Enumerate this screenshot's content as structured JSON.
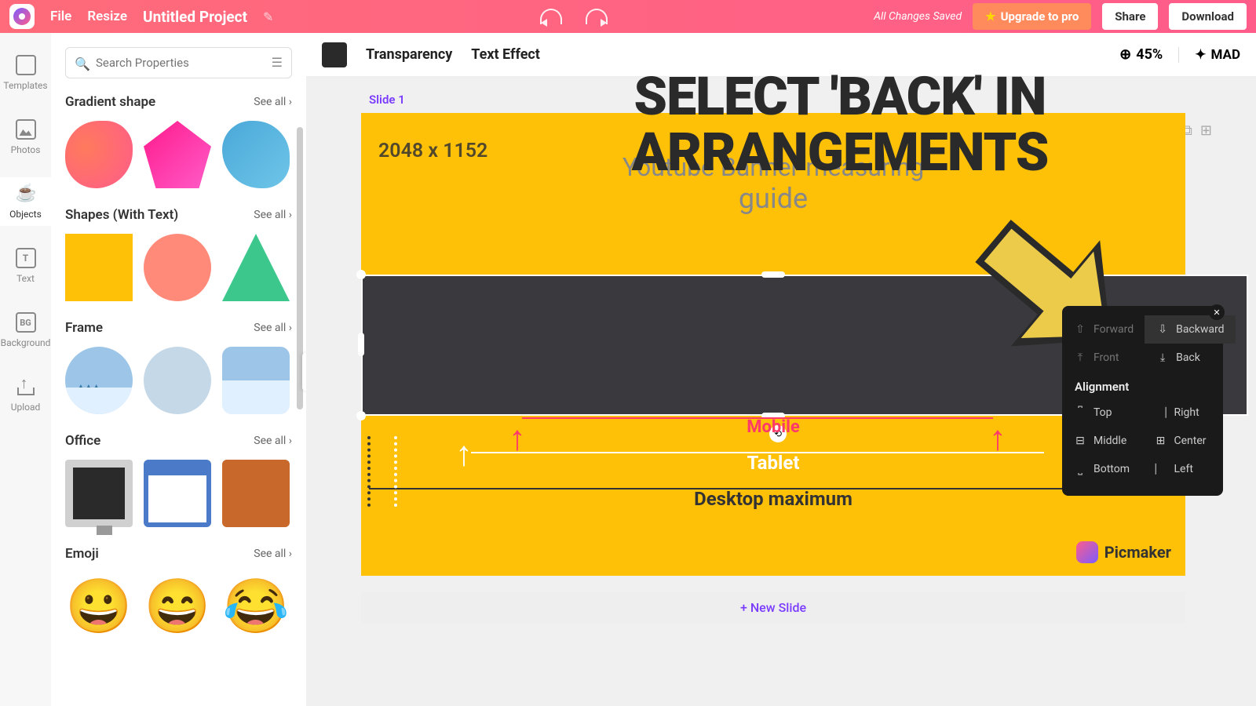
{
  "topbar": {
    "file": "File",
    "resize": "Resize",
    "project_title": "Untitled Project",
    "saved": "All Changes Saved",
    "upgrade": "Upgrade to pro",
    "share": "Share",
    "download": "Download"
  },
  "secbar": {
    "transparency": "Transparency",
    "text_effect": "Text Effect",
    "zoom": "45%",
    "mad": "MAD"
  },
  "rail": {
    "templates": "Templates",
    "photos": "Photos",
    "objects": "Objects",
    "text": "Text",
    "background": "Background",
    "upload": "Upload"
  },
  "panel": {
    "search_placeholder": "Search Properties",
    "see_all": "See all",
    "sections": {
      "gradient": "Gradient shape",
      "shapes_text": "Shapes (With Text)",
      "frame": "Frame",
      "office": "Office",
      "emoji": "Emoji"
    }
  },
  "canvas": {
    "slide_label": "Slide 1",
    "dimensions": "2048 x 1152",
    "subtitle_l1": "Youtube Banner measuring",
    "subtitle_l2": "guide",
    "mobile": "Mobile",
    "tablet": "Tablet",
    "desktop": "Desktop maximum",
    "brand": "Picmaker",
    "new_slide": "+ New Slide"
  },
  "overlay": {
    "title": "SELECT 'BACK' IN ARRANGEMENTS"
  },
  "ctx": {
    "forward": "Forward",
    "backward": "Backward",
    "front": "Front",
    "back": "Back",
    "alignment": "Alignment",
    "top": "Top",
    "right": "Right",
    "middle": "Middle",
    "center": "Center",
    "bottom": "Bottom",
    "left": "Left"
  }
}
